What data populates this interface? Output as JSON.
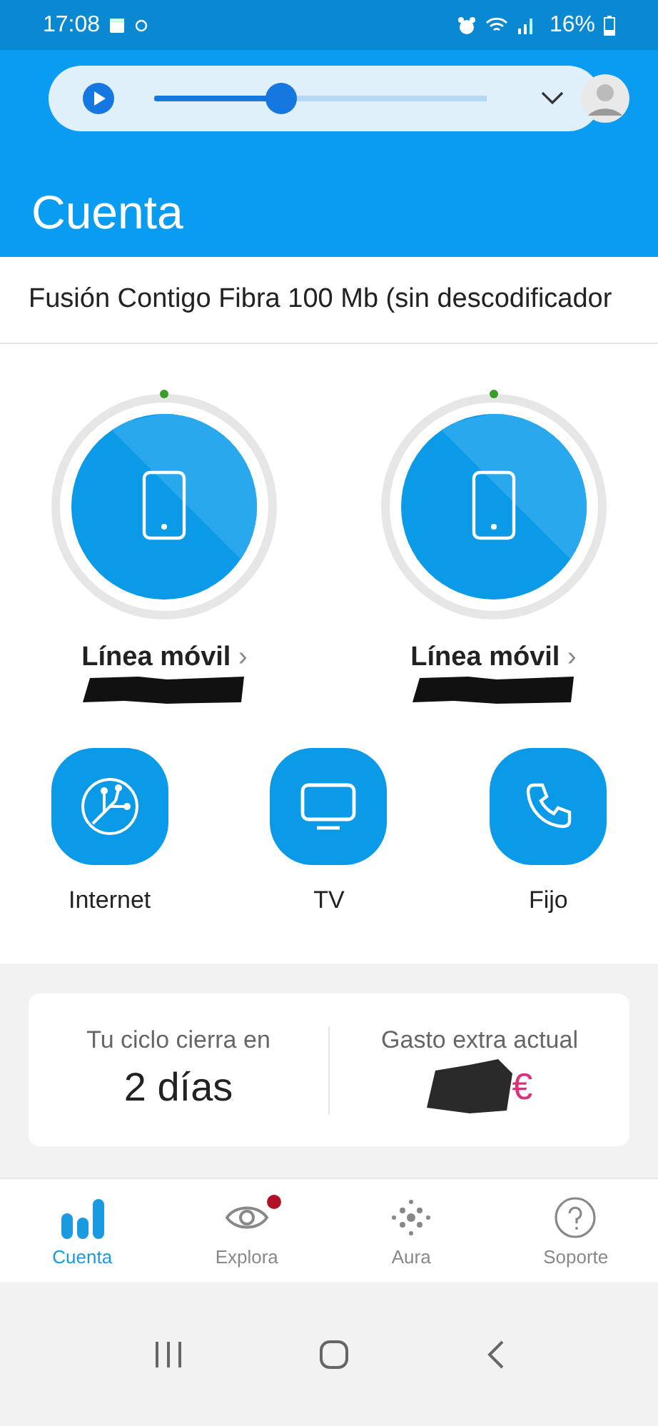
{
  "status_bar": {
    "time": "17:08",
    "battery": "16%"
  },
  "player": {
    "level": 0.38
  },
  "header": {
    "title": "Cuenta"
  },
  "plan": {
    "name": "Fusión Contigo Fibra 100 Mb (sin descodificador"
  },
  "lines": [
    {
      "label": "Línea móvil",
      "chevron": "›"
    },
    {
      "label": "Línea móvil",
      "chevron": "›"
    }
  ],
  "services": [
    {
      "kind": "internet",
      "label": "Internet"
    },
    {
      "kind": "tv",
      "label": "TV"
    },
    {
      "kind": "phone",
      "label": "Fijo"
    }
  ],
  "summary": [
    {
      "label": "Tu ciclo cierra en",
      "value": "2 días"
    },
    {
      "label": "Gasto extra actual",
      "value": "€",
      "redacted": true
    }
  ],
  "nav": [
    {
      "kind": "bars",
      "label": "Cuenta",
      "selected": true,
      "badge": false
    },
    {
      "kind": "eye",
      "label": "Explora",
      "selected": false,
      "badge": true
    },
    {
      "kind": "dots",
      "label": "Aura",
      "selected": false,
      "badge": false
    },
    {
      "kind": "help",
      "label": "Soporte",
      "selected": false,
      "badge": false
    }
  ]
}
